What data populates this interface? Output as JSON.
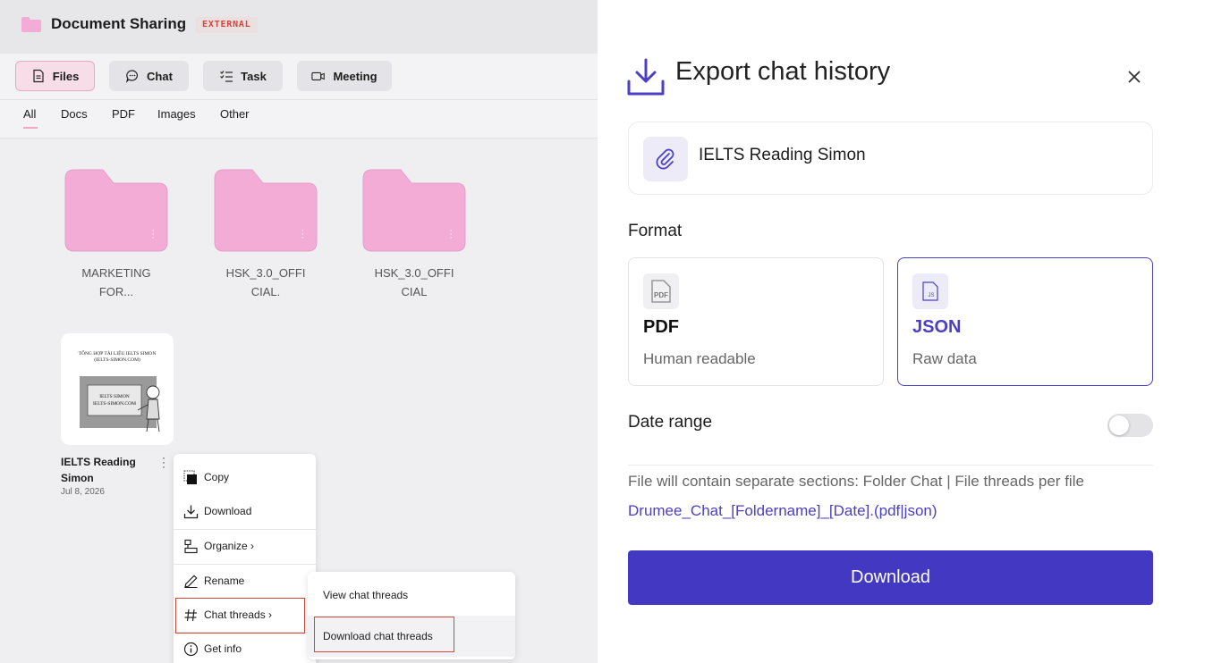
{
  "header": {
    "title": "Document Sharing",
    "badge": "EXTERNAL"
  },
  "tabs": [
    {
      "label": "Files",
      "icon": "file-icon",
      "active": true
    },
    {
      "label": "Chat",
      "icon": "chat-icon",
      "active": false
    },
    {
      "label": "Task",
      "icon": "checklist-icon",
      "active": false
    },
    {
      "label": "Meeting",
      "icon": "video-icon",
      "active": false
    }
  ],
  "filters": [
    "All",
    "Docs",
    "PDF",
    "Images",
    "Other"
  ],
  "folders": [
    {
      "line1": "MARKETING",
      "line2": "FOR..."
    },
    {
      "line1": "HSK_3.0_OFFI",
      "line2": "CIAL."
    },
    {
      "line1": "HSK_3.0_OFFI",
      "line2": "CIAL"
    }
  ],
  "file": {
    "title_line1": "IELTS Reading",
    "title_line2": "Simon",
    "date": "Jul 8, 2026",
    "thumb_line1": "TỔNG HỢP TÀI LIỆU IELTS SIMON",
    "thumb_line2": "(IELTS-SIMON.COM)",
    "thumb_sign1": "IELTS SIMON",
    "thumb_sign2": "IELTS-SIMON.COM"
  },
  "context_menu": {
    "copy": "Copy",
    "download": "Download",
    "organize": "Organize ›",
    "rename": "Rename",
    "chat_threads": "Chat threads ›",
    "get_info": "Get info"
  },
  "submenu": {
    "view": "View chat threads",
    "download": "Download chat threads"
  },
  "export": {
    "title": "Export chat history",
    "file_name": "IELTS Reading Simon",
    "format_label": "Format",
    "options": [
      {
        "name": "PDF",
        "desc": "Human readable",
        "tile": "PDF",
        "selected": false
      },
      {
        "name": "JSON",
        "desc": "Raw data",
        "tile": "JS",
        "selected": true
      }
    ],
    "date_range_label": "Date range",
    "date_range_enabled": false,
    "note": "File will contain separate sections: Folder Chat | File threads per file",
    "filename_pattern": "Drumee_Chat_[Foldername]_[Date].(pdf|json)",
    "download_label": "Download"
  },
  "colors": {
    "accent": "#4338c2",
    "folder": "#f2acd6",
    "highlight": "#d04a3a"
  }
}
